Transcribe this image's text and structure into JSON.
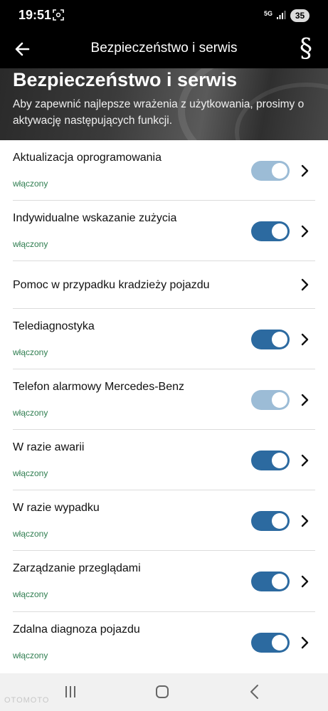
{
  "status_bar": {
    "time": "19:51",
    "network": "5G",
    "battery": "35"
  },
  "app_bar": {
    "title": "Bezpieczeństwo i serwis",
    "action_glyph": "§"
  },
  "hero": {
    "title": "Bezpieczeństwo i serwis",
    "description": "Aby zapewnić najlepsze wrażenia z użytkowania, prosimy o aktywację następujących funkcji."
  },
  "items": [
    {
      "label": "Aktualizacja oprogramowania",
      "status": "włączony",
      "toggle": "on-dim"
    },
    {
      "label": "Indywidualne wskazanie zużycia",
      "status": "włączony",
      "toggle": "on"
    },
    {
      "label": "Pomoc w przypadku kradzieży pojazdu",
      "status": "",
      "toggle": "none"
    },
    {
      "label": "Telediagnostyka",
      "status": "włączony",
      "toggle": "on"
    },
    {
      "label": "Telefon alarmowy Mercedes-Benz",
      "status": "włączony",
      "toggle": "on-dim"
    },
    {
      "label": "W razie awarii",
      "status": "włączony",
      "toggle": "on"
    },
    {
      "label": "W razie wypadku",
      "status": "włączony",
      "toggle": "on"
    },
    {
      "label": "Zarządzanie przeglądami",
      "status": "włączony",
      "toggle": "on"
    },
    {
      "label": "Zdalna diagnoza pojazdu",
      "status": "włączony",
      "toggle": "on"
    }
  ],
  "colors": {
    "toggle_on": "#2c6aa0",
    "toggle_dim": "#9cbcd6",
    "status_text": "#2e7d4f"
  },
  "watermark": "OTOMOTO"
}
